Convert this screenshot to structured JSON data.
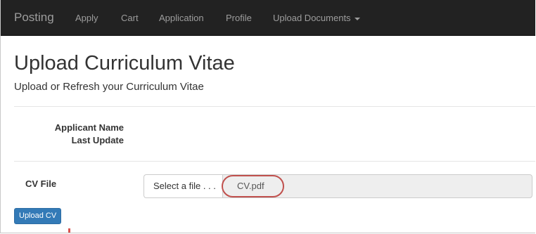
{
  "navbar": {
    "brand": "Posting",
    "items": [
      {
        "label": "Apply"
      },
      {
        "label": "Cart"
      },
      {
        "label": "Application"
      },
      {
        "label": "Profile"
      },
      {
        "label": "Upload Documents",
        "has_dropdown": true
      }
    ]
  },
  "page": {
    "title": "Upload Curriculum Vitae",
    "subtitle": "Upload or Refresh your Curriculum Vitae"
  },
  "applicant": {
    "name_label": "Applicant Name",
    "last_update_label": "Last Update"
  },
  "cv": {
    "label": "CV File",
    "select_button": "Select a file . . .",
    "file_name": "CV.pdf"
  },
  "actions": {
    "upload_button": "Upload CV"
  },
  "colors": {
    "navbar_bg": "#222222",
    "nav_text": "#9d9d9d",
    "primary": "#337ab7",
    "highlight_ring": "#c0504d"
  }
}
